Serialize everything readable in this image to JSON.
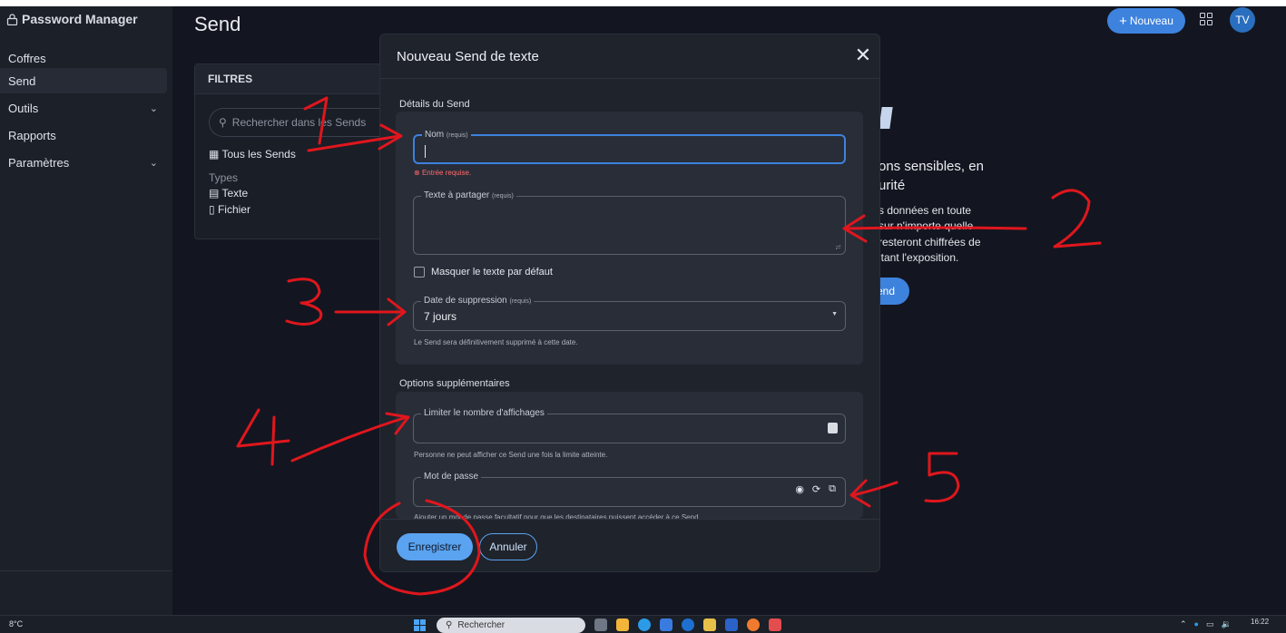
{
  "app": {
    "title": "Password Manager"
  },
  "sidebar": {
    "items": [
      {
        "label": "Coffres",
        "chevron": false
      },
      {
        "label": "Send",
        "chevron": false,
        "active": true
      },
      {
        "label": "Outils",
        "chevron": true
      },
      {
        "label": "Rapports",
        "chevron": false
      },
      {
        "label": "Paramètres",
        "chevron": true
      }
    ]
  },
  "page": {
    "title": "Send"
  },
  "topbar": {
    "new_label": "Nouveau",
    "avatar_initials": "TV"
  },
  "filters": {
    "heading": "FILTRES",
    "search_placeholder": "Rechercher dans les Sends",
    "all_sends": "Tous les Sends",
    "types_label": "Types",
    "type_text": "Texte",
    "type_file": "Fichier"
  },
  "background_text": {
    "heading_line1": "ons sensibles, en",
    "heading_line2": "urité",
    "body_line1": "s données en toute",
    "body_line2": "sur n'importe quelle",
    "body_line3": "resteront chiffrées de",
    "body_line4": "itant l'exposition.",
    "button_fragment": "end"
  },
  "modal": {
    "title": "Nouveau Send de texte",
    "section1_label": "Détails du Send",
    "name_field": {
      "label": "Nom",
      "required": "(requis)",
      "value": "",
      "error": "Entrée requise."
    },
    "text_field": {
      "label": "Texte à partager",
      "required": "(requis)",
      "value": ""
    },
    "hide_text_checkbox": {
      "label": "Masquer le texte par défaut",
      "checked": false
    },
    "deletion_date": {
      "label": "Date de suppression",
      "required": "(requis)",
      "value": "7 jours",
      "hint": "Le Send sera définitivement supprimé à cette date."
    },
    "section2_label": "Options supplémentaires",
    "max_views": {
      "label": "Limiter le nombre d'affichages",
      "value": "",
      "hint": "Personne ne peut afficher ce Send une fois la limite atteinte."
    },
    "password": {
      "label": "Mot de passe",
      "value": "",
      "hint": "Ajouter un mot de passe facultatif pour que les destinataires puissent accéder à ce Send."
    },
    "save_label": "Enregistrer",
    "cancel_label": "Annuler"
  },
  "taskbar": {
    "temperature": "8°C",
    "search_label": "Rechercher",
    "time": "16:22"
  },
  "annotations": {
    "numbers": [
      "1",
      "2",
      "3",
      "4",
      "5"
    ],
    "color": "#e0161d"
  },
  "colors": {
    "accent": "#3d82dd",
    "primary_button": "#5aa3f0",
    "error": "#ff6b6b",
    "background": "#131620",
    "sidebar": "#1c2028",
    "modal": "#1f232c"
  }
}
